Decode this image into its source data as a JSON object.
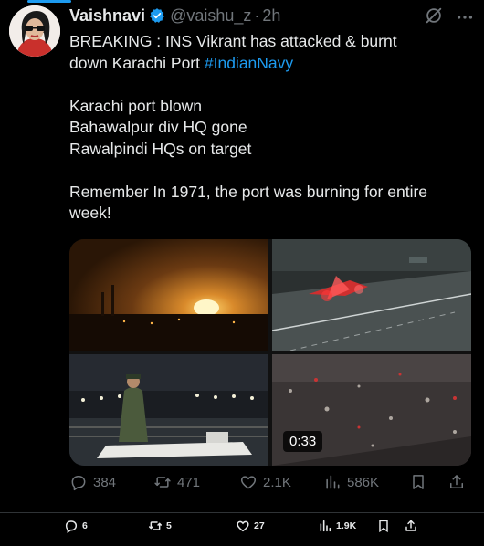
{
  "tweet": {
    "author_name": "Vaishnavi",
    "handle": "@vaishu_z",
    "separator": "·",
    "time": "2h",
    "lines": [
      "BREAKING : INS Vikrant has attacked & burnt",
      "down Karachi Port",
      "Karachi port blown",
      "Bahawalpur div HQ gone",
      "Rawalpindi HQs on target",
      "Remember In 1971, the port was burning for entire",
      "week!"
    ],
    "hashtag": "#IndianNavy",
    "video_duration": "0:33",
    "icons": {
      "verified": "verified-badge-icon",
      "grok": "grok-icon",
      "more": "more-icon"
    }
  },
  "actions": {
    "replies": "384",
    "reposts": "471",
    "likes": "2.1K",
    "views": "586K"
  },
  "bottom_actions": {
    "replies": "6",
    "reposts": "5",
    "likes": "27",
    "views": "1.9K"
  },
  "colors": {
    "background": "#000000",
    "text": "#e7e9ea",
    "muted": "#71767b",
    "accent": "#1d9bf0"
  }
}
